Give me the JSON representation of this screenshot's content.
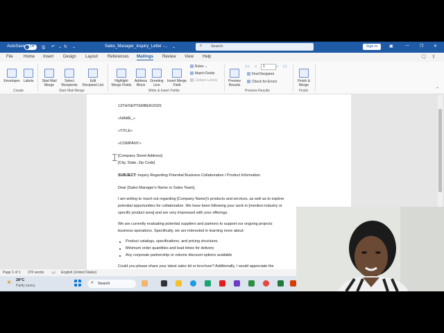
{
  "titlebar": {
    "autosave_label": "AutoSave",
    "autosave_state": "Off",
    "filename": "Sales_Manager_Inquiry_Letter  -...",
    "search_placeholder": "Search",
    "signin_label": "Sign in"
  },
  "menu": {
    "tabs": [
      "File",
      "Home",
      "Design",
      "Layout",
      "References",
      "Mailings",
      "Review",
      "View",
      "Help"
    ],
    "active": "Mailings"
  },
  "ribbon": {
    "envelopes": "Envelopes",
    "labels": "Labels",
    "start_mail_merge": "Start Mail\nMerge",
    "select_recipients": "Select\nRecipients",
    "edit_recipient_list": "Edit\nRecipient List",
    "highlight_merge_fields": "Highlight\nMerge Fields",
    "address_block": "Address\nBlock",
    "greeting_line": "Greeting\nLine",
    "insert_merge_field": "Insert Merge\nField",
    "rules": "Rules",
    "match_fields": "Match Fields",
    "update_labels": "Update Labels",
    "preview_results": "Preview\nResults",
    "record_number": "1",
    "find_recipient": "Find Recipient",
    "check_for_errors": "Check for Errors",
    "finish_merge": "Finish &\nMerge",
    "groups": {
      "create": "Create",
      "start_mail_merge": "Start Mail Merge",
      "write_insert_fields": "Write & Insert Fields",
      "preview_results": "Preview Results",
      "finish": "Finish"
    }
  },
  "document": {
    "date": "13TH/SEPTEMBER/2026",
    "name_field": "«NAME_»",
    "title_field": "«TITLE»",
    "company_field": "«COMPANY»",
    "street": "[Company Street Address]",
    "city": "[City, State, Zip Code]",
    "subject_label": "SUBJECT:",
    "subject_text": " Inquiry Regarding Potential Business Collaboration / Product Information",
    "greeting": "Dear [Sales Manager's Name or Sales Team],",
    "para1_l1": "I am writing to reach out regarding [Company Name]'s products and services, as well as to explore",
    "para1_l2": "potential opportunities for collaboration. We have been following your work in [mention industry or",
    "para1_l3": "specific product area] and are very impressed with your offerings.",
    "para2_l1": "We are currently evaluating potential suppliers and partners to support our ongoing projects",
    "para2_l2": "business operations. Specifically, we are interested in learning more about:",
    "bullets": [
      "Product catalogs, specifications, and pricing structures",
      "Minimum order quantities and lead times for delivery",
      "Any corporate partnership or volume discount options available"
    ],
    "para3_l1": "Could you please share your latest sales kit or brochure? Additionally, I would appreciate the"
  },
  "status": {
    "page": "Page 1 of 1",
    "words": "370 words",
    "language": "English (United States)"
  },
  "taskbar": {
    "weather_temp": "28°C",
    "weather_desc": "Partly sunny",
    "search_label": "Search"
  }
}
